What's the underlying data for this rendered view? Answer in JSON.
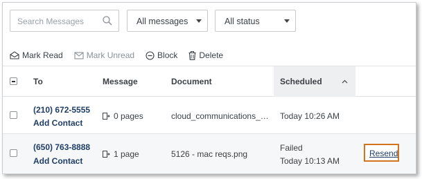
{
  "filters": {
    "search_placeholder": "Search Messages",
    "type_select": "All messages",
    "status_select": "All status"
  },
  "actions": {
    "mark_read": "Mark Read",
    "mark_unread": "Mark Unread",
    "block": "Block",
    "delete": "Delete"
  },
  "table": {
    "headers": {
      "to": "To",
      "message": "Message",
      "document": "Document",
      "scheduled": "Scheduled"
    },
    "rows": [
      {
        "phone": "(210) 672-5555",
        "add_contact": "Add Contact",
        "pages": "0 pages",
        "document": "cloud_communications_…",
        "status": "",
        "scheduled": "Today 10:26 AM",
        "action": ""
      },
      {
        "phone": "(650) 763-8888",
        "add_contact": "Add Contact",
        "pages": "1 page",
        "document": "5126 - mac reqs.png",
        "status": "Failed",
        "scheduled": "Today 10:13 AM",
        "action": "Resend"
      }
    ]
  },
  "colors": {
    "highlight": "#d3741d",
    "link": "#1f3d66"
  }
}
